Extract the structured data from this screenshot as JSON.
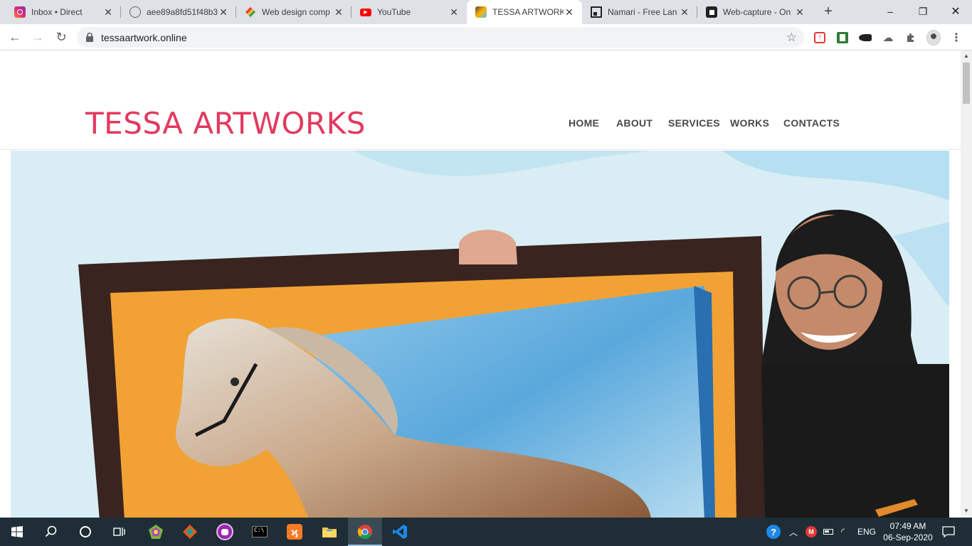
{
  "browser": {
    "tabs": [
      {
        "title": "Inbox • Direct",
        "icon": "instagram-icon",
        "color": "#d6249f"
      },
      {
        "title": "aee89a8fd51f48b3",
        "icon": "globe-icon",
        "color": "#5f6368"
      },
      {
        "title": "Web design comp",
        "icon": "diamond-icon",
        "color": "#2e7d32"
      },
      {
        "title": "YouTube",
        "icon": "youtube-icon",
        "color": "#ff0000"
      },
      {
        "title": "TESSA ARTWORKS",
        "icon": "art-favicon-icon",
        "color": "#8d6e63"
      },
      {
        "title": "Namari - Free Lan",
        "icon": "namari-icon",
        "color": "#202124"
      },
      {
        "title": "Web-capture - On",
        "icon": "capture-icon",
        "color": "#202124"
      }
    ],
    "close_glyph": "✕",
    "new_tab_glyph": "+",
    "window": {
      "minimize": "–",
      "maximize": "❐",
      "close": "✕"
    },
    "url": "tessaartwork.online",
    "nav": {
      "back": "←",
      "forward": "→",
      "reload": "↻",
      "star": "☆"
    }
  },
  "site": {
    "brand": "TESSA ARTWORKS",
    "brand_color": "#e23a5f",
    "nav": [
      "HOME",
      "ABOUT",
      "SERVICES",
      "WORKS",
      "CONTACTS"
    ]
  },
  "taskbar": {
    "apps": [
      "windows-start-icon",
      "search-icon",
      "cortana-icon",
      "task-view-icon",
      "app-polygon-icon",
      "git-icon",
      "cat-app-icon",
      "terminal-icon",
      "xampp-icon",
      "file-explorer-icon",
      "chrome-icon",
      "vscode-icon"
    ],
    "language": "ENG",
    "time": "07:49 AM",
    "date": "06-Sep-2020"
  }
}
